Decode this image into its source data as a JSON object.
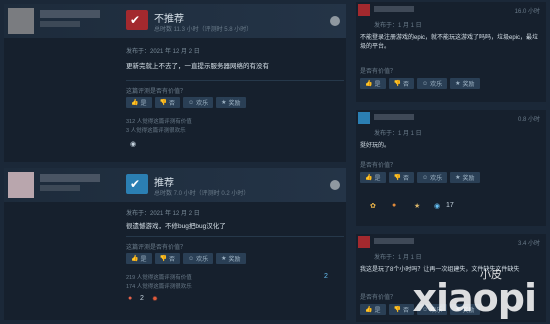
{
  "reviews": [
    {
      "verdict": "不推荐",
      "hours": "总时数 11.3 小时（评测时 5.8 小时）",
      "posted": "发布于：2021 年 12 月 2 日",
      "body": "更新完就上不去了，一直提示服务器网络的有没有",
      "helpful_q": "这篇评测是否有价值？",
      "buttons": [
        "是",
        "否",
        "欢乐",
        "奖励"
      ],
      "stats": [
        "312 人觉得这篇评测有价值",
        "3 人觉得这篇评测很欢乐"
      ]
    },
    {
      "verdict": "推荐",
      "hours": "总时数 7.0 小时（评测时 0.2 小时）",
      "posted": "发布于：2021 年 12 月 2 日",
      "body": "很遗憾游戏，不修bug把bug汉化了",
      "helpful_q": "这篇评测是否有价值？",
      "buttons": [
        "是",
        "否",
        "欢乐",
        "奖励"
      ],
      "stats": [
        "219 人觉得这篇评测有价值",
        "174 人觉得这篇评测很欢乐"
      ],
      "comment_count": "2",
      "award_count": "2"
    }
  ],
  "comments": [
    {
      "time": "16.0 小时",
      "posted": "发布于：1 月 1 日",
      "text": "不能登录注册游戏的epic，就不能玩这游戏了吗吗，垃圾epic，最垃圾的平台。",
      "helpful_q": "是否有价值？",
      "buttons": [
        "是",
        "否",
        "欢乐",
        "奖励"
      ]
    },
    {
      "time": "0.8 小时",
      "posted": "发布于：1 月 1 日",
      "text": "挺好玩的。",
      "helpful_q": "是否有价值？",
      "buttons": [
        "是",
        "否",
        "欢乐",
        "奖励"
      ],
      "award_count": "17"
    },
    {
      "time": "3.4 小时",
      "posted": "发布于：1 月 1 日",
      "text": "我这是玩了8个小时吗？让再一次组建失，文件缺失文件缺失",
      "helpful_q": "是否有价值？",
      "buttons": [
        "是",
        "否",
        "欢乐",
        "奖励"
      ]
    }
  ],
  "watermark": {
    "brand": "xiaopi",
    "small": "小皮"
  }
}
